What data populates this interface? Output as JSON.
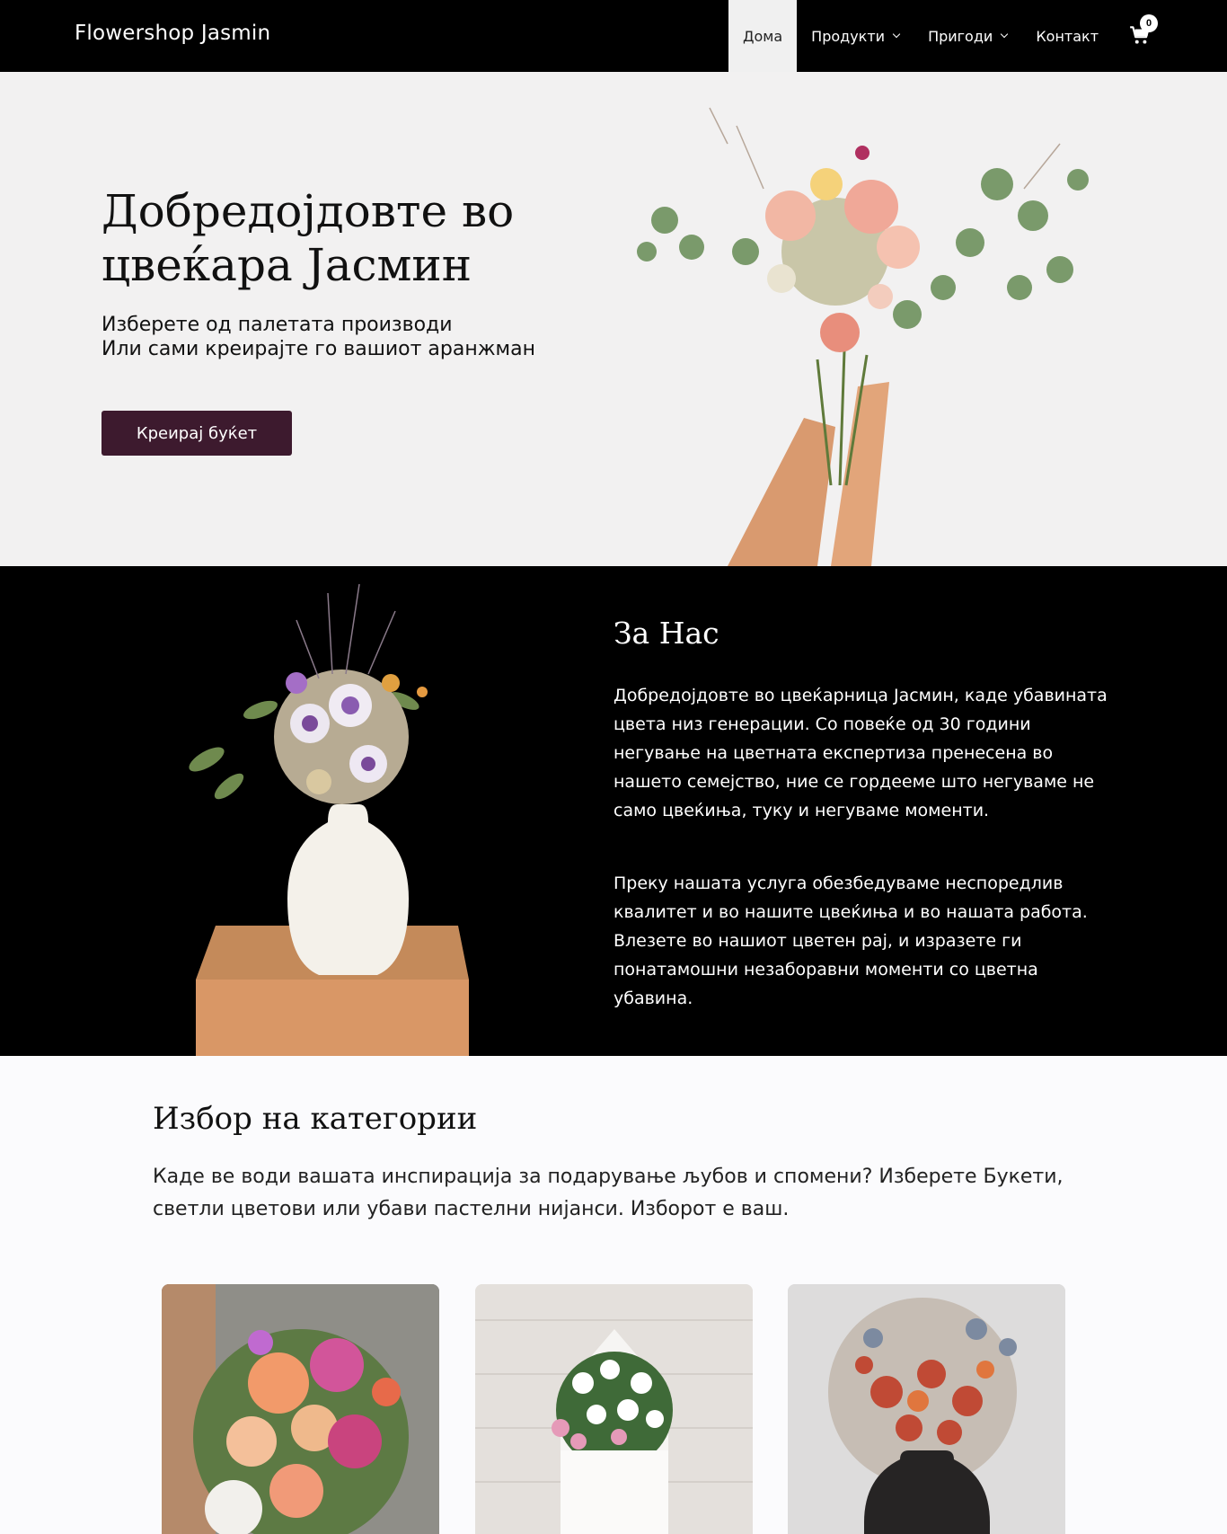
{
  "header": {
    "brand": "Flowershop Jasmin",
    "nav": [
      {
        "label": "Дома",
        "active": true,
        "has_dropdown": false
      },
      {
        "label": "Продукти",
        "active": false,
        "has_dropdown": true
      },
      {
        "label": "Пригоди",
        "active": false,
        "has_dropdown": true
      },
      {
        "label": "Контакт",
        "active": false,
        "has_dropdown": false
      }
    ],
    "cart": {
      "icon": "cart-icon",
      "count": "0"
    }
  },
  "hero": {
    "title": "Добредојдовте во цвеќара Јасмин",
    "subtitle_line1": "Изберете од палетата производи",
    "subtitle_line2": "Или сами креирајте го вашиот аранжман",
    "cta_label": "Креирај буќет"
  },
  "about": {
    "title": "За Нас",
    "paragraph1": "Добредојдовте во цвеќарница Јасмин, каде убавината цвета низ генерации. Со повеќе од 30 години негување на цветната експертиза пренесена во нашето семејство, ние се гордееме што негуваме не само цвеќиња, туку и негуваме моменти.",
    "paragraph2": "Преку нашата услуга обезбедуваме неспоредлив квалитет и во нашите цвеќиња и во нашата работа. Влезете во нашиот цветен рај, и изразете ги понатамошни незаборавни моменти со цветна убавина."
  },
  "categories": {
    "title": "Избор на категории",
    "description": "Каде ве води вашата инспирација за подарување љубов и спомени? Изберете Букети, светли цветови или убави пастелни нијанси. Изборот е ваш."
  },
  "colors": {
    "header_bg": "#000000",
    "hero_bg": "#f2f1f1",
    "cta_bg": "#3d1a2e",
    "about_bg": "#000000",
    "page_bg": "#fbfbfd"
  }
}
